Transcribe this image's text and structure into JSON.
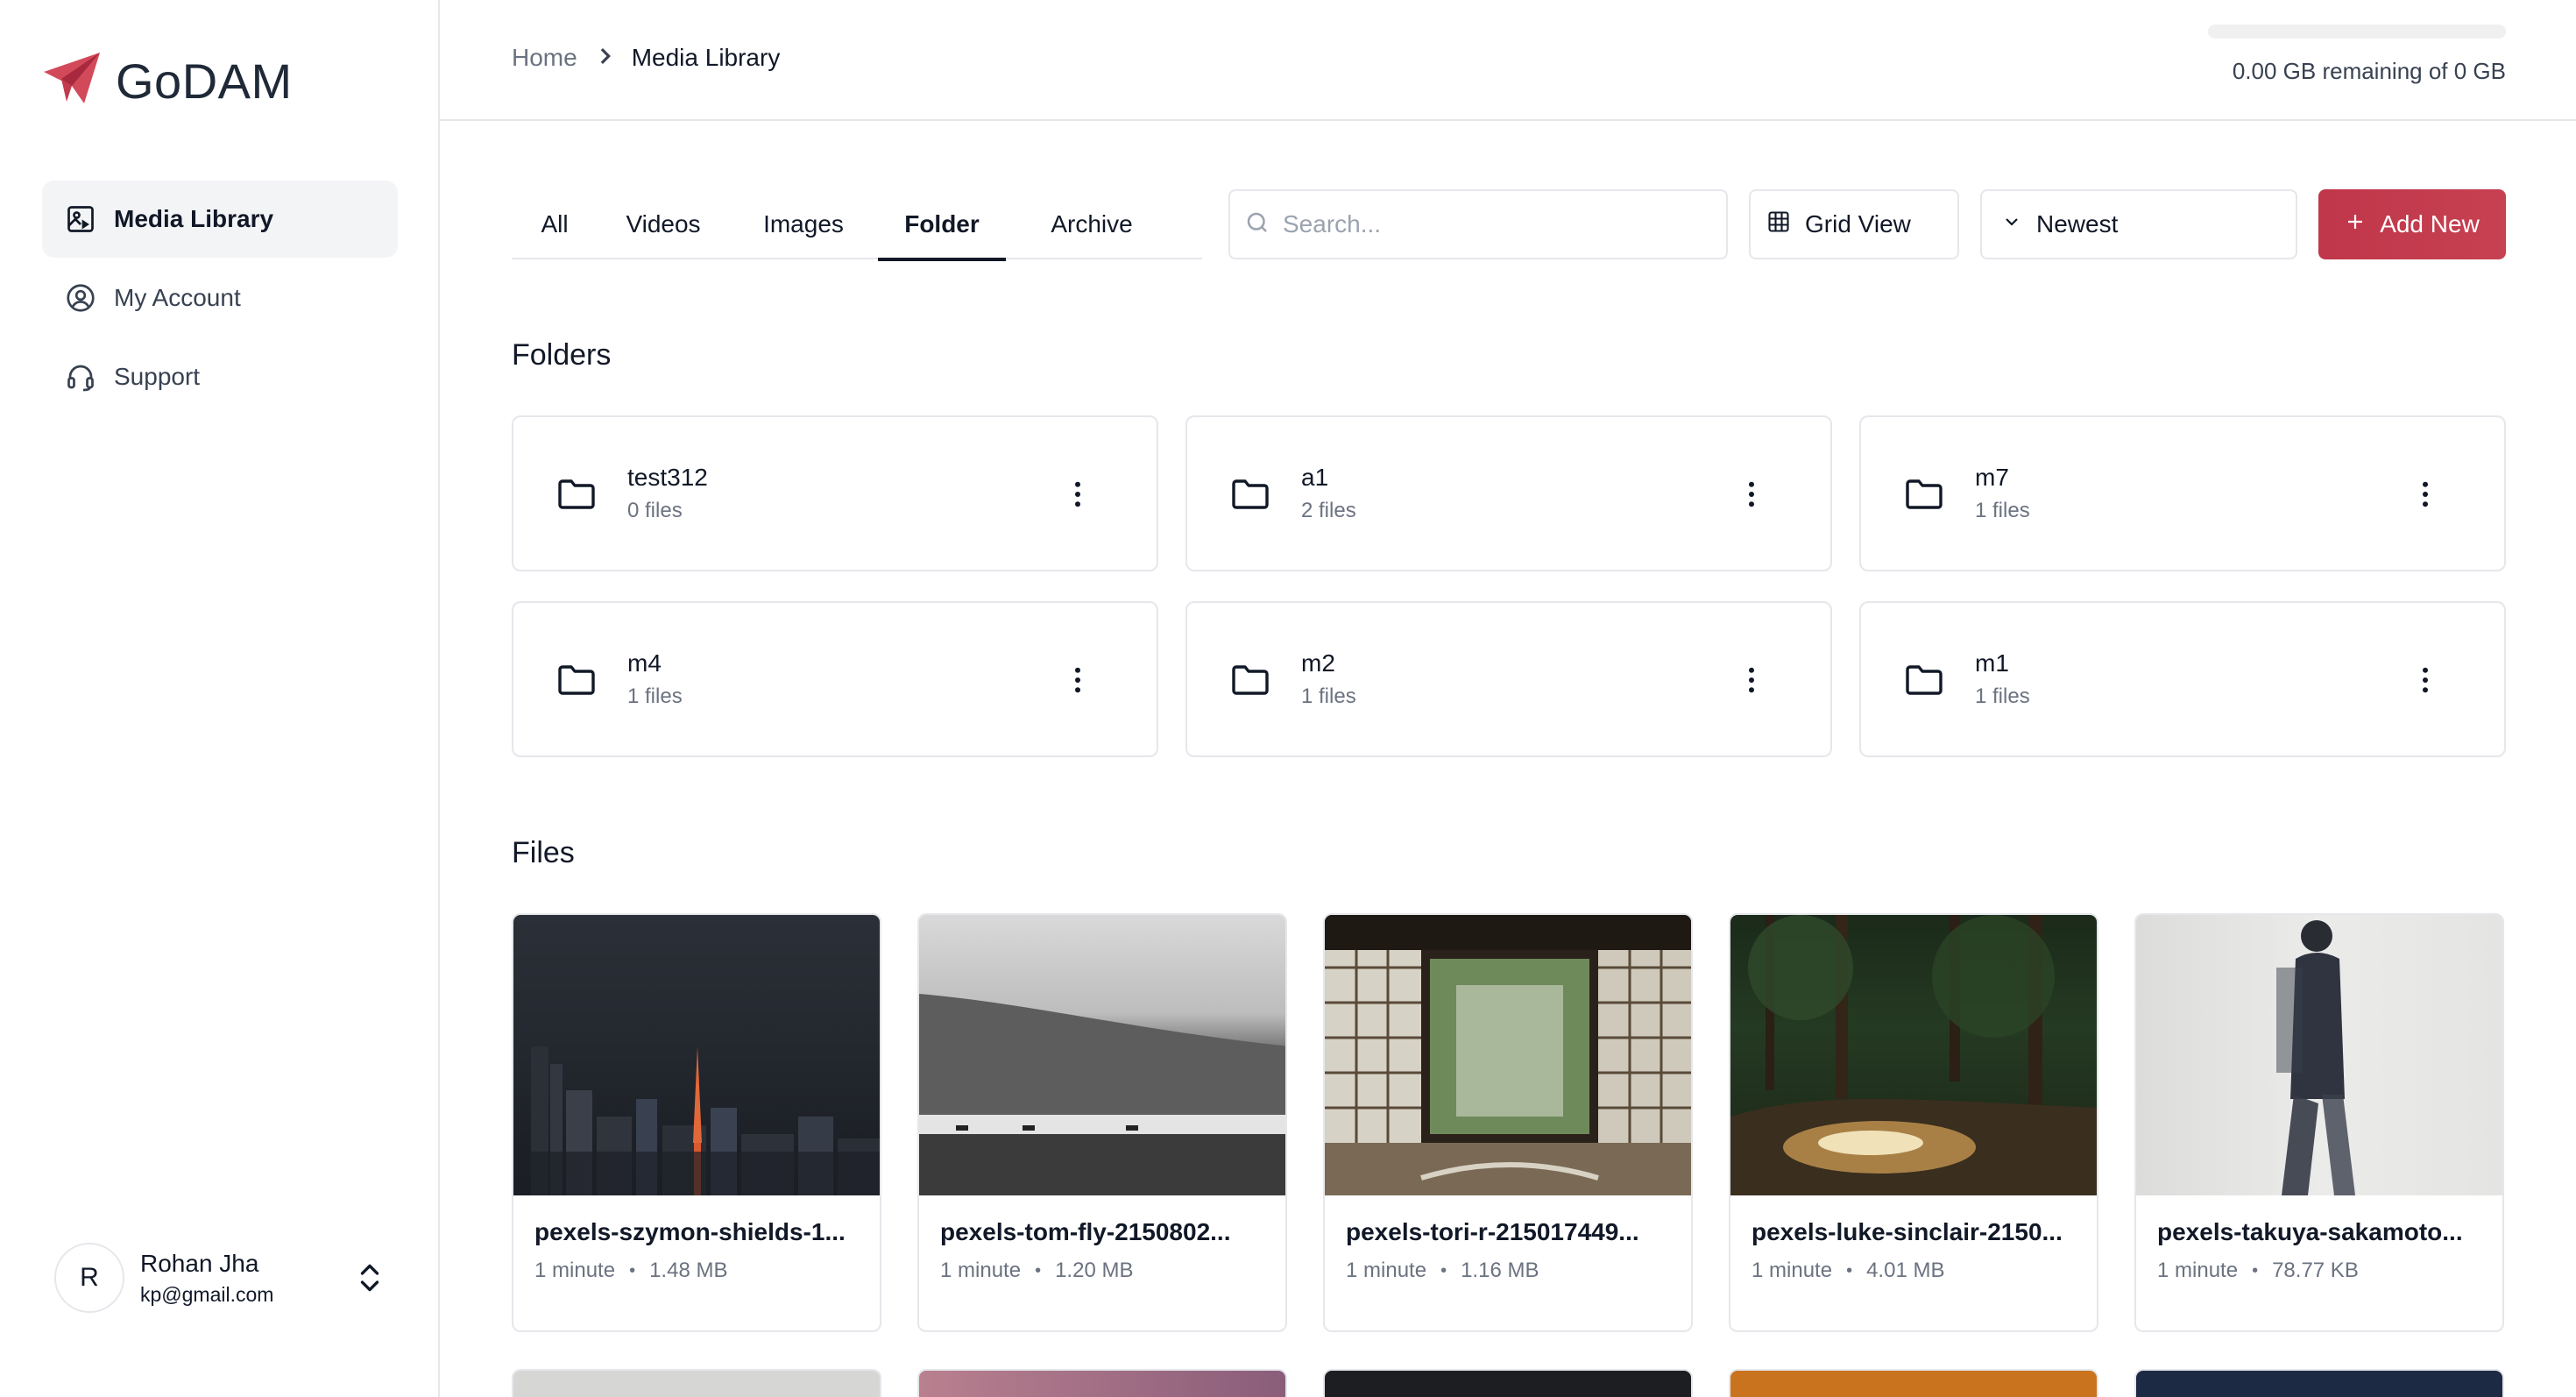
{
  "app": {
    "name": "GoDAM"
  },
  "sidebar": {
    "items": [
      {
        "label": "Media Library",
        "icon": "media-library-icon"
      },
      {
        "label": "My Account",
        "icon": "user-circle-icon"
      },
      {
        "label": "Support",
        "icon": "headset-icon"
      }
    ],
    "user": {
      "initial": "R",
      "name": "Rohan Jha",
      "email": "kp@gmail.com"
    }
  },
  "header": {
    "breadcrumb": {
      "home": "Home",
      "current": "Media Library"
    },
    "storage": {
      "text": "0.00 GB remaining of 0 GB",
      "used_fraction": 0
    }
  },
  "toolbar": {
    "tabs": [
      "All",
      "Videos",
      "Images",
      "Folder",
      "Archive"
    ],
    "active_tab": "Folder",
    "search_placeholder": "Search...",
    "view_label": "Grid View",
    "sort_label": "Newest",
    "add_label": "Add New"
  },
  "folders_section": {
    "title": "Folders",
    "items": [
      {
        "name": "test312",
        "count": "0 files"
      },
      {
        "name": "a1",
        "count": "2 files"
      },
      {
        "name": "m7",
        "count": "1 files"
      },
      {
        "name": "m4",
        "count": "1 files"
      },
      {
        "name": "m2",
        "count": "1 files"
      },
      {
        "name": "m1",
        "count": "1 files"
      }
    ]
  },
  "files_section": {
    "title": "Files",
    "items": [
      {
        "name": "pexels-szymon-shields-1...",
        "age": "1 minute",
        "size": "1.48 MB"
      },
      {
        "name": "pexels-tom-fly-2150802...",
        "age": "1 minute",
        "size": "1.20 MB"
      },
      {
        "name": "pexels-tori-r-215017449...",
        "age": "1 minute",
        "size": "1.16 MB"
      },
      {
        "name": "pexels-luke-sinclair-2150...",
        "age": "1 minute",
        "size": "4.01 MB"
      },
      {
        "name": "pexels-takuya-sakamoto...",
        "age": "1 minute",
        "size": "78.77 KB"
      }
    ]
  },
  "colors": {
    "accent": "#c0364a",
    "border": "#e5e7eb",
    "muted": "#6b7280"
  }
}
